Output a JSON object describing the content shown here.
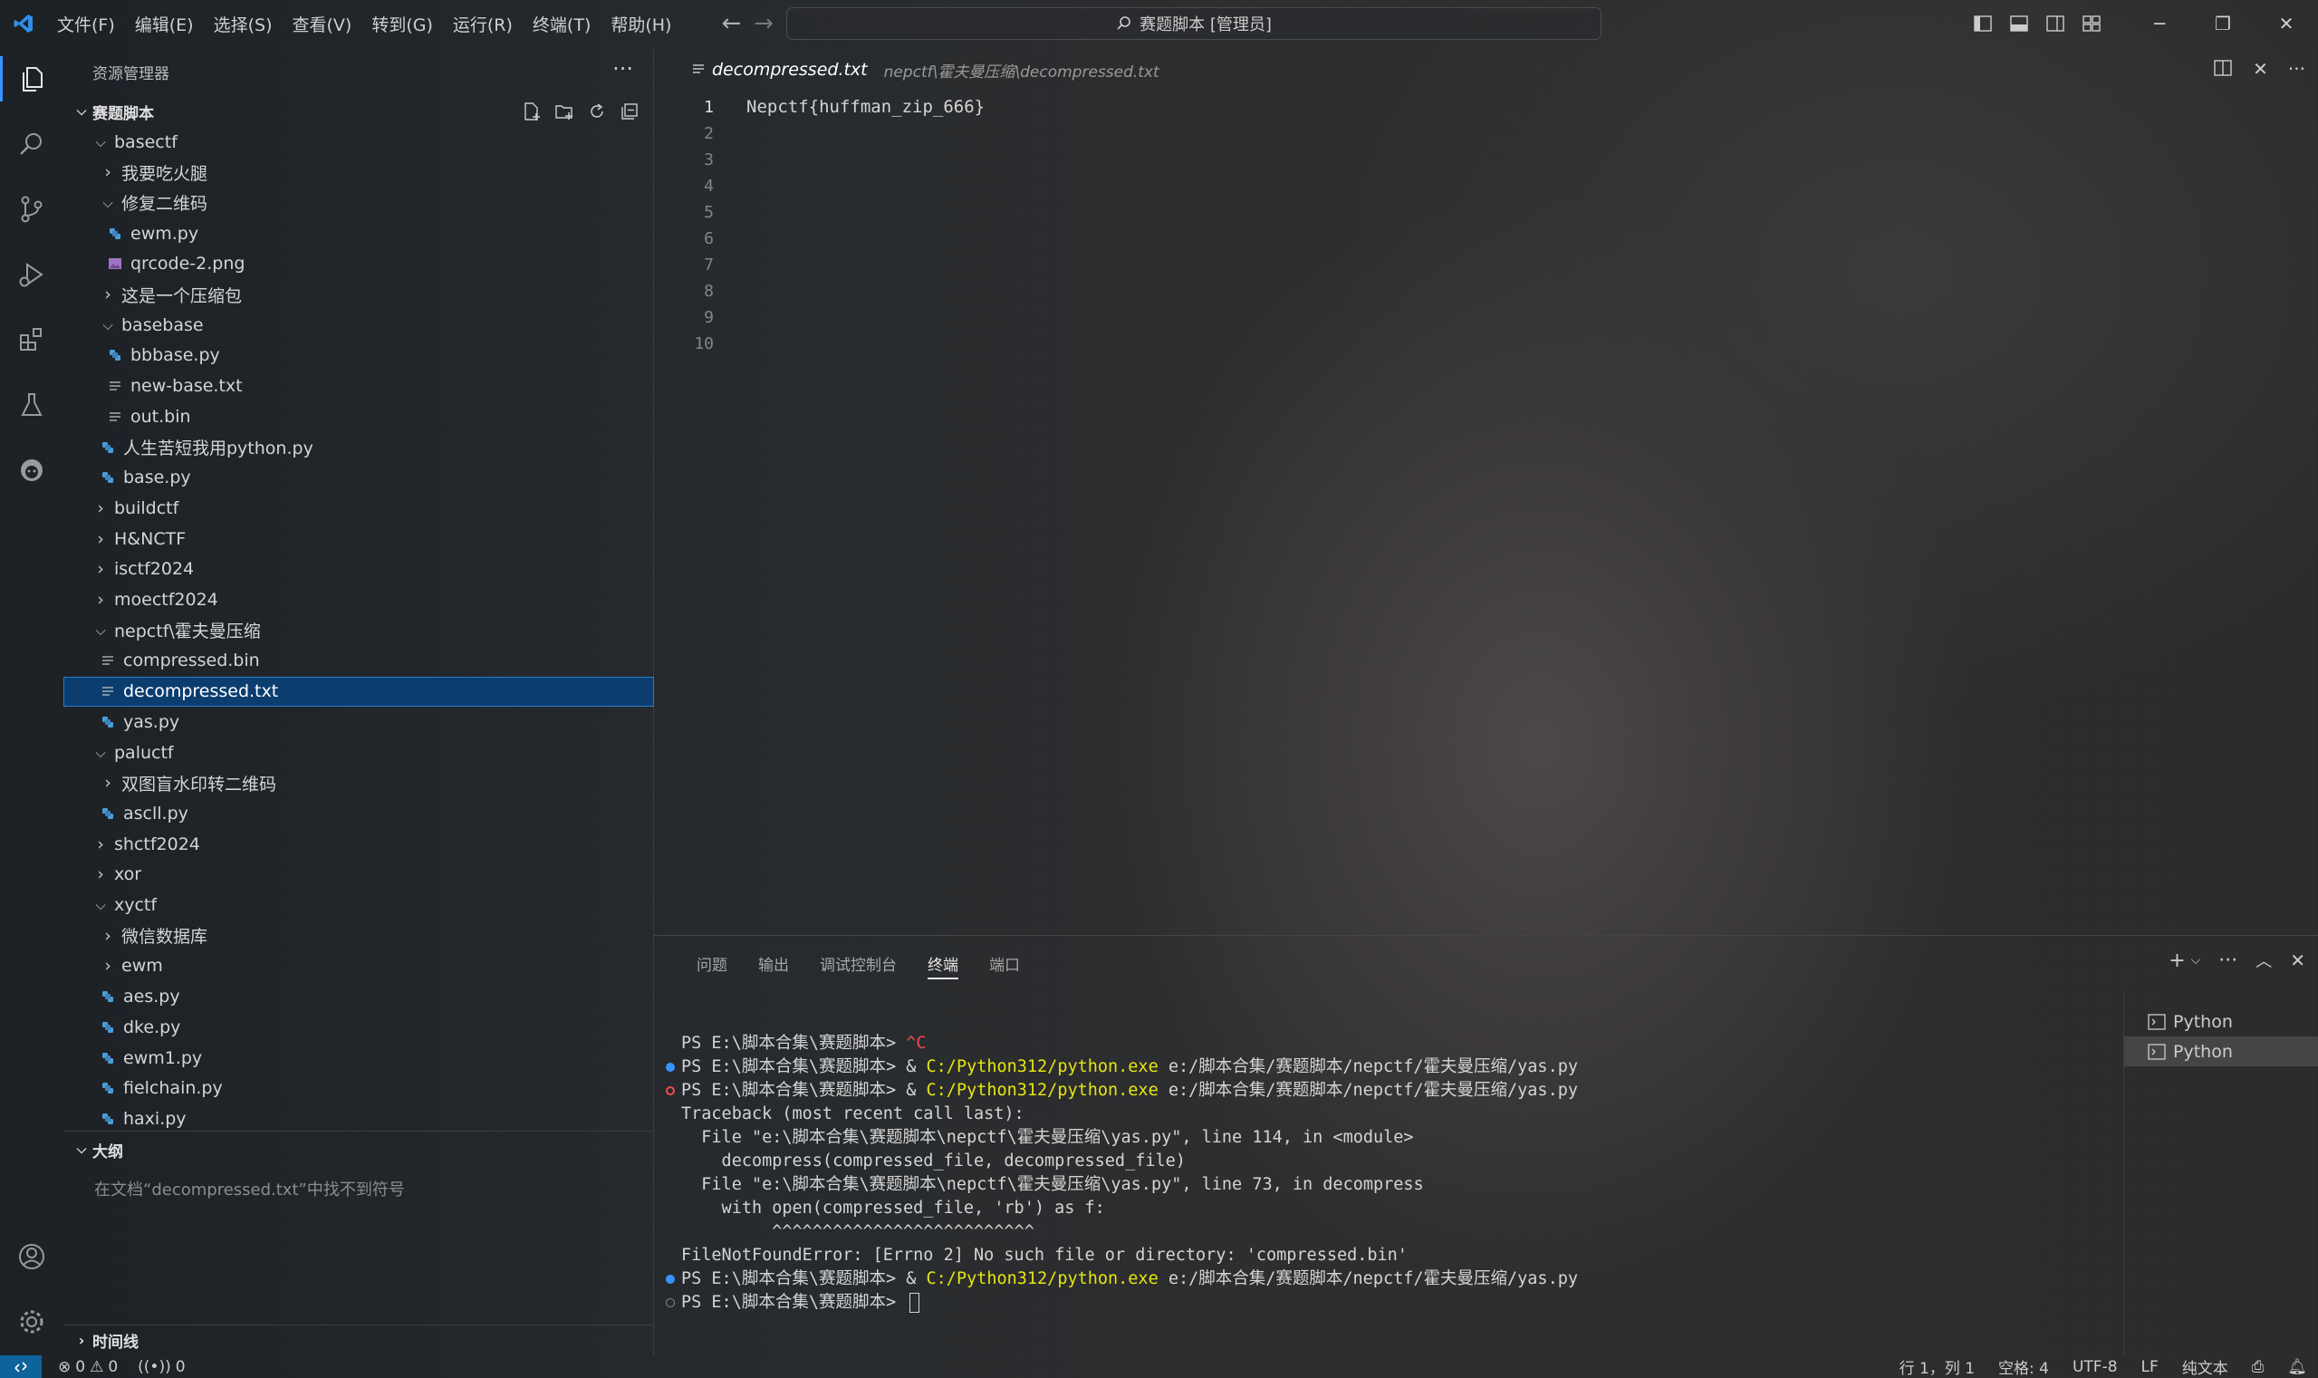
{
  "titlebar": {
    "menu": [
      "文件(F)",
      "编辑(E)",
      "选择(S)",
      "查看(V)",
      "转到(G)",
      "运行(R)",
      "终端(T)",
      "帮助(H)"
    ],
    "search_text": "赛题脚本 [管理员]"
  },
  "sidebar": {
    "title": "资源管理器",
    "root": "赛题脚本",
    "tree": [
      {
        "label": "basectf",
        "kind": "folder-open",
        "depth": 0
      },
      {
        "label": "我要吃火腿",
        "kind": "folder",
        "depth": 1
      },
      {
        "label": "修复二维码",
        "kind": "folder-open",
        "depth": 1
      },
      {
        "label": "ewm.py",
        "kind": "py",
        "depth": 2
      },
      {
        "label": "qrcode-2.png",
        "kind": "png",
        "depth": 2
      },
      {
        "label": "这是一个压缩包",
        "kind": "folder",
        "depth": 1
      },
      {
        "label": "basebase",
        "kind": "folder-open",
        "depth": 1
      },
      {
        "label": "bbbase.py",
        "kind": "py",
        "depth": 2
      },
      {
        "label": "new-base.txt",
        "kind": "txt",
        "depth": 2
      },
      {
        "label": "out.bin",
        "kind": "txt",
        "depth": 2
      },
      {
        "label": "人生苦短我用python.py",
        "kind": "py",
        "depth": 1
      },
      {
        "label": "base.py",
        "kind": "py",
        "depth": 1
      },
      {
        "label": "buildctf",
        "kind": "folder",
        "depth": 0
      },
      {
        "label": "H&NCTF",
        "kind": "folder",
        "depth": 0
      },
      {
        "label": "isctf2024",
        "kind": "folder",
        "depth": 0
      },
      {
        "label": "moectf2024",
        "kind": "folder",
        "depth": 0
      },
      {
        "label": "nepctf\\霍夫曼压缩",
        "kind": "folder-open",
        "depth": 0
      },
      {
        "label": "compressed.bin",
        "kind": "txt",
        "depth": 1
      },
      {
        "label": "decompressed.txt",
        "kind": "txt",
        "depth": 1,
        "selected": true
      },
      {
        "label": "yas.py",
        "kind": "py",
        "depth": 1
      },
      {
        "label": "paluctf",
        "kind": "folder-open",
        "depth": 0
      },
      {
        "label": "双图盲水印转二维码",
        "kind": "folder",
        "depth": 1
      },
      {
        "label": "ascll.py",
        "kind": "py",
        "depth": 1
      },
      {
        "label": "shctf2024",
        "kind": "folder",
        "depth": 0
      },
      {
        "label": "xor",
        "kind": "folder",
        "depth": 0
      },
      {
        "label": "xyctf",
        "kind": "folder-open",
        "depth": 0
      },
      {
        "label": "微信数据库",
        "kind": "folder",
        "depth": 1
      },
      {
        "label": "ewm",
        "kind": "folder",
        "depth": 1
      },
      {
        "label": "aes.py",
        "kind": "py",
        "depth": 1
      },
      {
        "label": "dke.py",
        "kind": "py",
        "depth": 1
      },
      {
        "label": "ewm1.py",
        "kind": "py",
        "depth": 1
      },
      {
        "label": "fielchain.py",
        "kind": "py",
        "depth": 1
      },
      {
        "label": "haxi.py",
        "kind": "py",
        "depth": 1
      }
    ],
    "outline_title": "大纲",
    "outline_empty": "在文档“decompressed.txt”中找不到符号",
    "timeline_title": "时间线"
  },
  "editor": {
    "tab_name": "decompressed.txt",
    "tab_path": "nepctf\\霍夫曼压缩\\decompressed.txt",
    "line_numbers": [
      "1",
      "2",
      "3",
      "4",
      "5",
      "6",
      "7",
      "8",
      "9",
      "10"
    ],
    "line1": "Nepctf{huffman_zip_666}"
  },
  "panel": {
    "tabs": [
      "问题",
      "输出",
      "调试控制台",
      "终端",
      "端口"
    ],
    "active_tab": "终端",
    "terminal_items": [
      "Python",
      "Python"
    ],
    "lines": {
      "l1_prompt": "PS E:\\脚本合集\\赛题脚本> ",
      "l1_ctrl": "^C",
      "l2_prompt": "PS E:\\脚本合集\\赛题脚本> & ",
      "l2_exe": "C:/Python312/python.exe",
      "l2_arg": " e:/脚本合集/赛题脚本/nepctf/霍夫曼压缩/yas.py",
      "l3_prompt": "PS E:\\脚本合集\\赛题脚本> & ",
      "l3_exe": "C:/Python312/python.exe",
      "l3_arg": " e:/脚本合集/赛题脚本/nepctf/霍夫曼压缩/yas.py",
      "l4": "Traceback (most recent call last):",
      "l5": "  File \"e:\\脚本合集\\赛题脚本\\nepctf\\霍夫曼压缩\\yas.py\", line 114, in <module>",
      "l6": "    decompress(compressed_file, decompressed_file)",
      "l7": "  File \"e:\\脚本合集\\赛题脚本\\nepctf\\霍夫曼压缩\\yas.py\", line 73, in decompress",
      "l8": "    with open(compressed_file, 'rb') as f:",
      "l9": "         ^^^^^^^^^^^^^^^^^^^^^^^^^^",
      "l10": "FileNotFoundError: [Errno 2] No such file or directory: 'compressed.bin'",
      "l11_prompt": "PS E:\\脚本合集\\赛题脚本> & ",
      "l11_exe": "C:/Python312/python.exe",
      "l11_arg": " e:/脚本合集/赛题脚本/nepctf/霍夫曼压缩/yas.py",
      "l12_prompt": "PS E:\\脚本合集\\赛题脚本> "
    }
  },
  "statusbar": {
    "errors": "0",
    "warnings": "0",
    "ports": "0",
    "position": "行 1，列 1",
    "spaces": "空格: 4",
    "encoding": "UTF-8",
    "eol": "LF",
    "language": "纯文本"
  },
  "colors": {
    "accent": "#3794ff",
    "selection": "#0b3d6f",
    "python_icon": "#4a9fd8",
    "terminal_yellow": "#e5e510",
    "terminal_red": "#f14c4c"
  }
}
